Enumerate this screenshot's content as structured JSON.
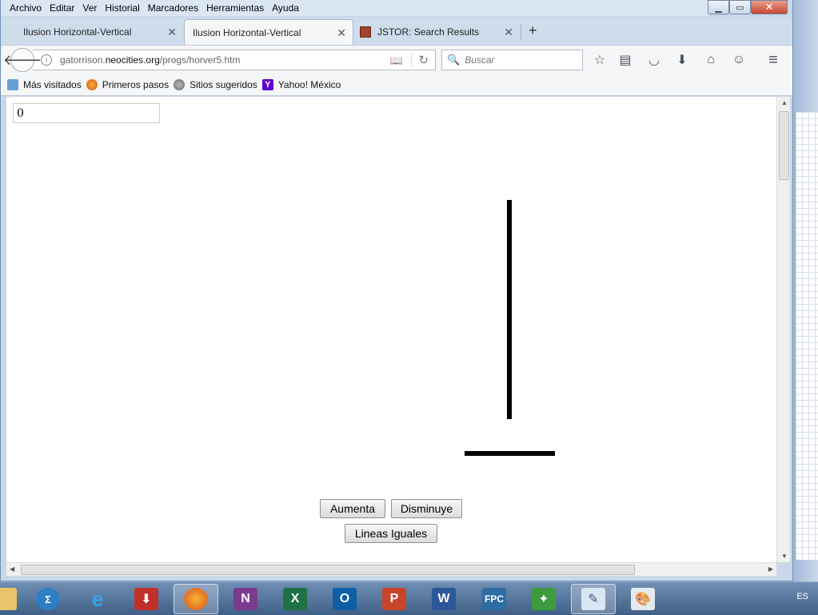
{
  "menu": [
    "Archivo",
    "Editar",
    "Ver",
    "Historial",
    "Marcadores",
    "Herramientas",
    "Ayuda"
  ],
  "window_controls": {
    "minimize": "▁",
    "maximize": "▭",
    "close": "✕"
  },
  "tabs": [
    {
      "label": "Ilusion Horizontal-Vertical",
      "active": false
    },
    {
      "label": "Ilusion Horizontal-Vertical",
      "active": true
    },
    {
      "label": "JSTOR: Search Results",
      "active": false
    }
  ],
  "url": {
    "prefix": "gatorrison.",
    "domain": "neocities.org",
    "path": "/progs/horver5.htm"
  },
  "search": {
    "placeholder": "Buscar"
  },
  "bookmarks": [
    {
      "label": "Más visitados",
      "icon": "most-visited-icon"
    },
    {
      "label": "Primeros pasos",
      "icon": "firefox-icon"
    },
    {
      "label": "Sitios sugeridos",
      "icon": "globe-icon"
    },
    {
      "label": "Yahoo! México",
      "icon": "yahoo-icon"
    }
  ],
  "page": {
    "counter_value": "0",
    "buttons": {
      "increase": "Aumenta",
      "decrease": "Disminuye",
      "equal": "Lineas Iguales"
    }
  },
  "taskbar": {
    "language": "ES",
    "apps": [
      "file-manager-icon",
      "math-input-icon",
      "internet-explorer-icon",
      "media-recorder-icon",
      "firefox-icon",
      "onenote-icon",
      "excel-icon",
      "outlook-icon",
      "powerpoint-icon",
      "word-icon",
      "fpc-icon",
      "game-icon",
      "notepad-icon",
      "paint-icon"
    ]
  },
  "colors": {
    "lines": "#000000",
    "taskbar": "#4f6f96"
  }
}
